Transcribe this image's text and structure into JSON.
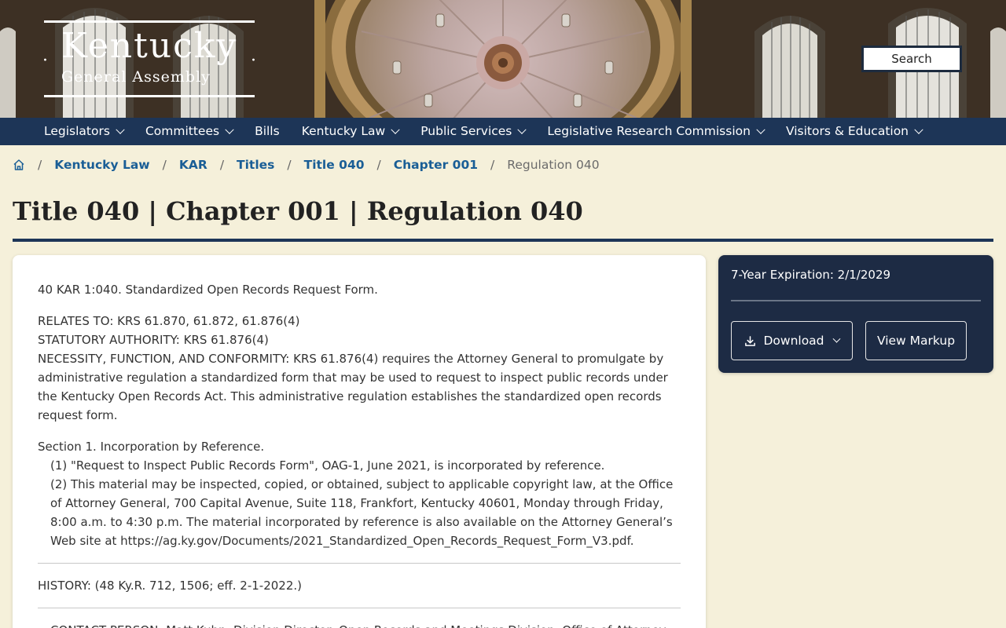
{
  "header": {
    "logo_title": "Kentucky",
    "logo_subtitle": "General Assembly",
    "search_label": "Search"
  },
  "nav": {
    "items": [
      {
        "label": "Legislators",
        "has_dropdown": true
      },
      {
        "label": "Committees",
        "has_dropdown": true
      },
      {
        "label": "Bills",
        "has_dropdown": false
      },
      {
        "label": "Kentucky Law",
        "has_dropdown": true
      },
      {
        "label": "Public Services",
        "has_dropdown": true
      },
      {
        "label": "Legislative Research Commission",
        "has_dropdown": true
      },
      {
        "label": "Visitors & Education",
        "has_dropdown": true
      }
    ]
  },
  "breadcrumb": {
    "home_icon": "home-icon",
    "items": [
      "Kentucky Law",
      "KAR",
      "Titles",
      "Title 040",
      "Chapter 001"
    ],
    "current": "Regulation 040"
  },
  "page_title": "Title 040 | Chapter 001 | Regulation 040",
  "regulation": {
    "heading": "40 KAR 1:040.  Standardized Open Records Request Form.",
    "relates_to": "RELATES TO:  KRS 61.870, 61.872, 61.876(4)",
    "statutory_authority": "STATUTORY AUTHORITY:  KRS 61.876(4)",
    "necessity": "NECESSITY, FUNCTION, AND CONFORMITY:  KRS 61.876(4) requires the Attorney General to promulgate by administrative regulation a standardized form that may be used to request to inspect public records under the Kentucky Open Records Act. This administrative regulation establishes the standardized open records request form.",
    "section1": "Section 1.  Incorporation by Reference.",
    "section1_item1": "(1)  \"Request to Inspect Public Records Form\", OAG-1, June 2021, is incorporated by reference.",
    "section1_item2": "(2)  This material may be inspected, copied, or obtained, subject to applicable copyright law, at the Office of Attorney General, 700 Capital Avenue, Suite 118, Frankfort, Kentucky 40601, Monday through Friday, 8:00 a.m. to 4:30 p.m. The material incorporated by reference is also available on the Attorney General’s Web site at https://ag.ky.gov/Documents/2021_Standardized_Open_Records_Request_Form_V3.pdf.",
    "history": "HISTORY:   (48 Ky.R. 712, 1506; eff. 2-1-2022.)",
    "contact_partial": "CONTACT PERSON:  Matt Kuhn, Division Director, Open Records and Meetings Division, Office of Attorney"
  },
  "side_panel": {
    "expiration": "7-Year Expiration: 2/1/2029",
    "download_label": "Download",
    "download_icon": "download-icon",
    "view_markup_label": "View Markup"
  },
  "colors": {
    "nav_bg": "#1d3557",
    "page_bg": "#f5f0da",
    "link": "#1a5e96",
    "side_panel_bg": "#1d2b44"
  }
}
